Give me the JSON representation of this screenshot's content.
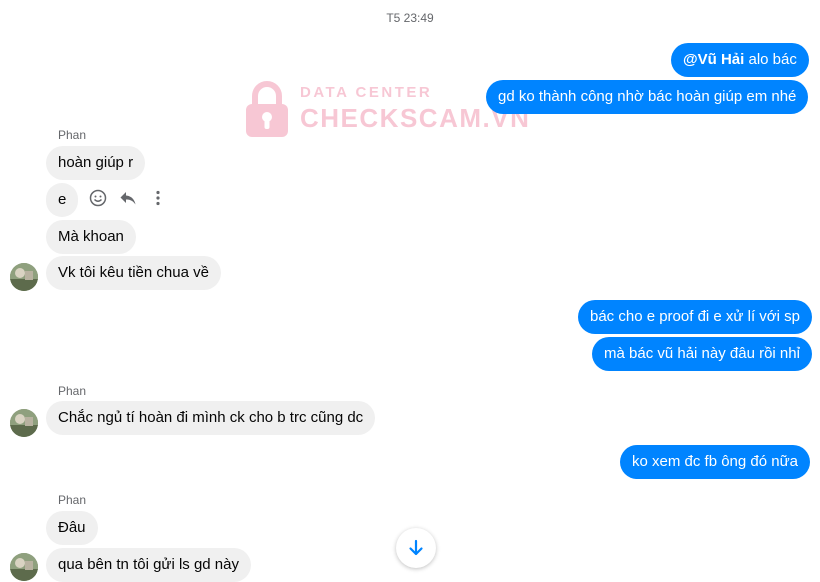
{
  "timestamp": "T5 23:49",
  "watermark": {
    "line1": "DATA CENTER",
    "line2": "CHECKSCAM.VN"
  },
  "messages": {
    "m1": {
      "mention": "@Vũ Hải",
      "text": " alo bác"
    },
    "m2": "gd ko thành công nhờ bác hoàn giúp em nhé",
    "sender1": "Phan",
    "m3": "hoàn giúp r",
    "m4": "e",
    "m5": "Mà khoan",
    "m6": "Vk tôi kêu tiền chua về",
    "m7": "bác cho e proof đi e xử lí với sp",
    "m8": "mà bác vũ hải này đâu rồi nhỉ",
    "sender2": "Phan",
    "m9": "Chắc ngủ tí hoàn đi mình ck cho b trc cũng dc",
    "m10": "ko xem đc fb ông đó nữa",
    "sender3": "Phan",
    "m11": "Đâu",
    "m12": "qua bên tn tôi gửi ls gd này"
  },
  "icons": {
    "react": "smiley-icon",
    "reply": "reply-icon",
    "more": "more-vertical-icon",
    "scroll": "arrow-down-icon"
  },
  "colors": {
    "outgoing": "#0084ff",
    "incoming": "#f0f0f0",
    "watermark": "#f29ab2"
  }
}
